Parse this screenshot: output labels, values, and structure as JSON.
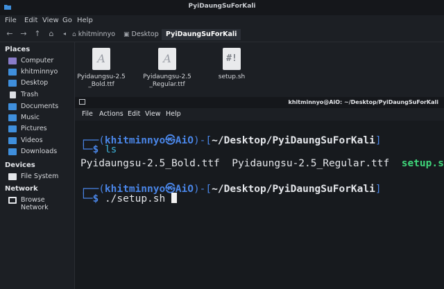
{
  "window": {
    "title": "PyiDaungSuForKali"
  },
  "menubar": {
    "items": [
      "File",
      "Edit",
      "View",
      "Go",
      "Help"
    ]
  },
  "toolbar": {
    "breadcrumbs": [
      "khitminnyo",
      "Desktop",
      "PyiDaungSuForKali"
    ]
  },
  "sidebar": {
    "places_heading": "Places",
    "places": [
      "Computer",
      "khitminnyo",
      "Desktop",
      "Trash",
      "Documents",
      "Music",
      "Pictures",
      "Videos",
      "Downloads"
    ],
    "devices_heading": "Devices",
    "devices": [
      "File System"
    ],
    "network_heading": "Network",
    "network": [
      "Browse Network"
    ]
  },
  "files": [
    {
      "name": "Pyidaungsu-2.5_Bold.ttf",
      "glyph": "A"
    },
    {
      "name": "Pyidaungsu-2.5_Regular.ttf",
      "glyph": "A"
    },
    {
      "name": "setup.sh",
      "glyph": "#!"
    }
  ],
  "terminal": {
    "title": "khitminnyo@AiO: ~/Desktop/PyiDaungSuForKali",
    "menu": [
      "File",
      "Actions",
      "Edit",
      "View",
      "Help"
    ],
    "prompt_user": "khitminnyo",
    "prompt_at": "㉿",
    "prompt_host": "AiO",
    "prompt_path": "~/Desktop/PyiDaungSuForKali",
    "cmd1": "ls",
    "ls_out": [
      "Pyidaungsu-2.5_Bold.ttf",
      "Pyidaungsu-2.5_Regular.ttf",
      "setup.sh"
    ],
    "cmd2": "./setup.sh"
  },
  "colors": {
    "accent": "#4a86e8",
    "folder": "#3f8fdc",
    "exec": "#3fd67a"
  }
}
